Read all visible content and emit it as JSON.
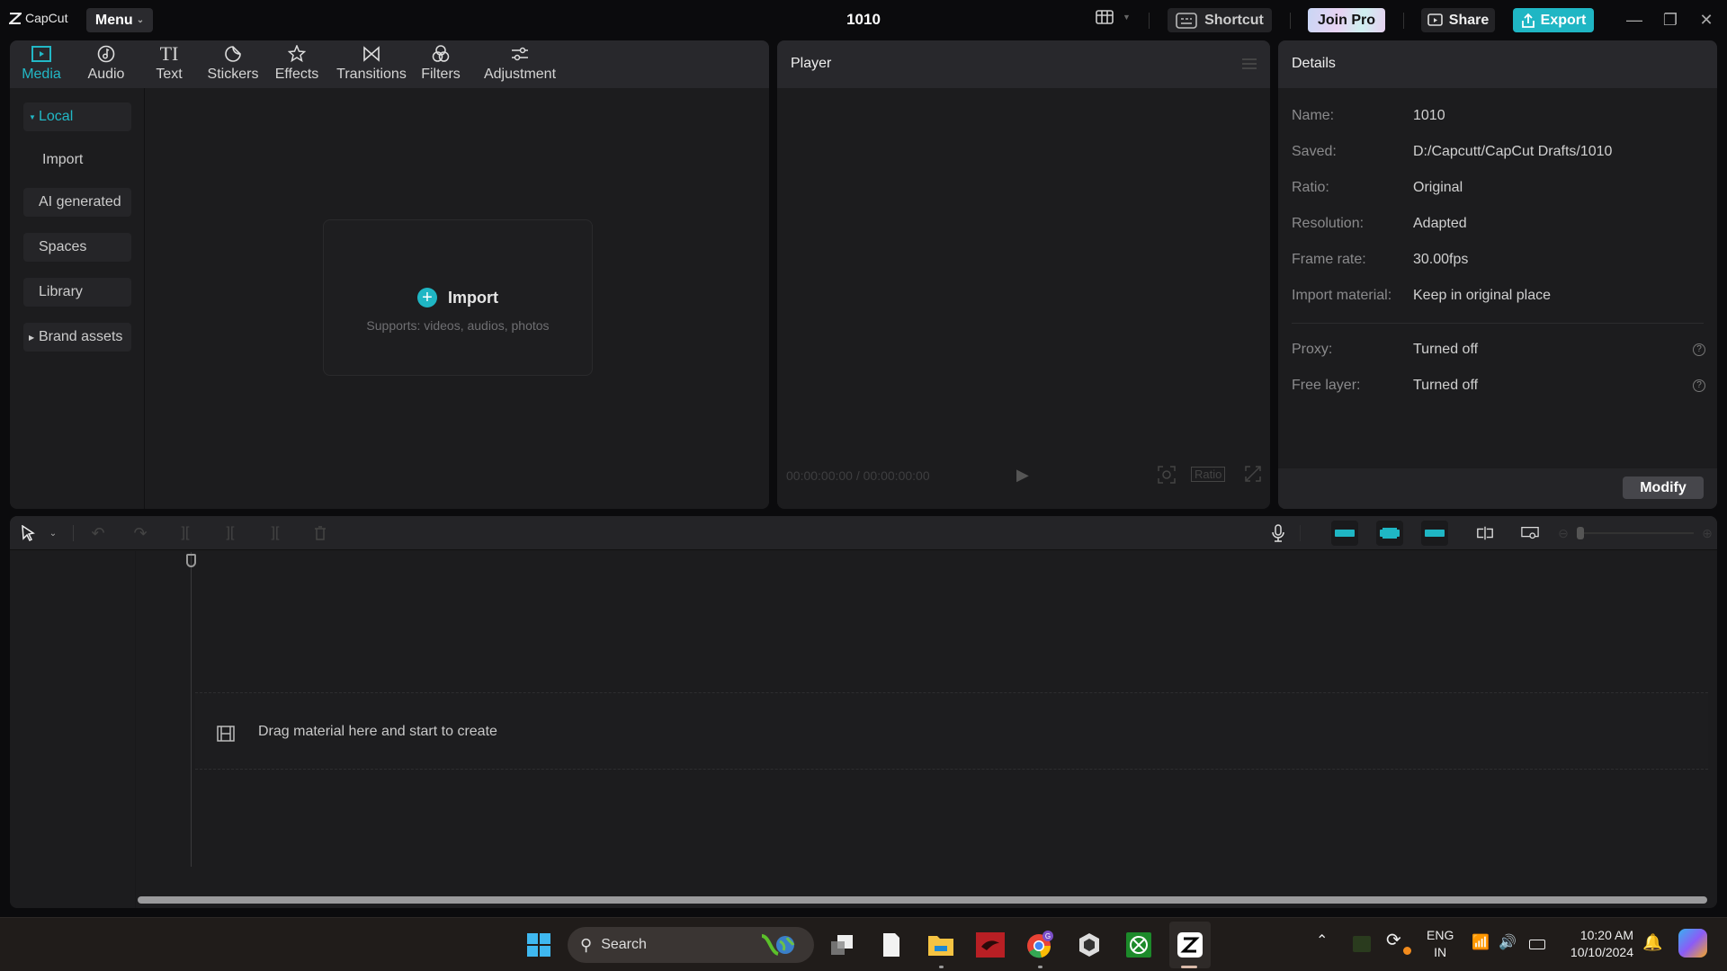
{
  "app": {
    "logo": "CapCut",
    "menu_label": "Menu",
    "project_title": "1010",
    "shortcut_label": "Shortcut",
    "join_pro_label": "Join Pro",
    "share_label": "Share",
    "export_label": "Export",
    "accent_color": "#1fb6c4"
  },
  "media_tabs": [
    {
      "label": "Media",
      "icon": "media-icon",
      "active": true
    },
    {
      "label": "Audio",
      "icon": "audio-icon"
    },
    {
      "label": "Text",
      "icon": "text-icon"
    },
    {
      "label": "Stickers",
      "icon": "stickers-icon"
    },
    {
      "label": "Effects",
      "icon": "effects-icon"
    },
    {
      "label": "Transitions",
      "icon": "transitions-icon"
    },
    {
      "label": "Filters",
      "icon": "filters-icon"
    },
    {
      "label": "Adjustment",
      "icon": "adjustment-icon"
    }
  ],
  "media_sidebar": [
    {
      "label": "Local",
      "expanded": true,
      "active": true
    },
    {
      "label": "Import"
    },
    {
      "label": "AI generated"
    },
    {
      "label": "Spaces"
    },
    {
      "label": "Library"
    },
    {
      "label": "Brand assets",
      "expanded": false
    }
  ],
  "import_box": {
    "label": "Import",
    "subtitle": "Supports: videos, audios, photos"
  },
  "player": {
    "title": "Player",
    "current_time": "00:00:00:00",
    "total_time": "00:00:00:00",
    "ratio_label": "Ratio"
  },
  "details": {
    "title": "Details",
    "rows": [
      {
        "label": "Name:",
        "value": "1010"
      },
      {
        "label": "Saved:",
        "value": "D:/Capcutt/CapCut Drafts/1010"
      },
      {
        "label": "Ratio:",
        "value": "Original"
      },
      {
        "label": "Resolution:",
        "value": "Adapted"
      },
      {
        "label": "Frame rate:",
        "value": "30.00fps"
      },
      {
        "label": "Import material:",
        "value": "Keep in original place"
      }
    ],
    "extra_rows": [
      {
        "label": "Proxy:",
        "value": "Turned off"
      },
      {
        "label": "Free layer:",
        "value": "Turned off"
      }
    ],
    "modify_label": "Modify"
  },
  "timeline": {
    "drop_hint": "Drag material here and start to create"
  },
  "taskbar": {
    "search_placeholder": "Search",
    "language": "ENG",
    "region": "IN",
    "time": "10:20 AM",
    "date": "10/10/2024"
  }
}
